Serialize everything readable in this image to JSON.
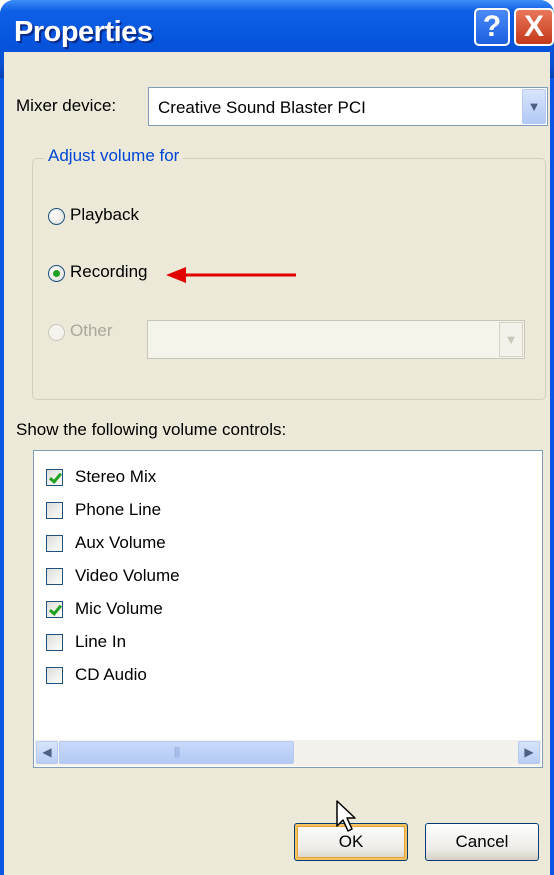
{
  "window": {
    "title": "Properties",
    "help_glyph": "?",
    "close_glyph": "X"
  },
  "mixer": {
    "label": "Mixer device:",
    "selected": "Creative Sound Blaster PCI",
    "arrow_glyph": "▼"
  },
  "adjust_volume": {
    "legend": "Adjust volume for",
    "options": [
      {
        "label": "Playback",
        "checked": false,
        "enabled": true
      },
      {
        "label": "Recording",
        "checked": true,
        "enabled": true
      },
      {
        "label": "Other",
        "checked": false,
        "enabled": false
      }
    ],
    "other_select_value": ""
  },
  "controls": {
    "heading": "Show the following volume controls:",
    "items": [
      {
        "label": "Stereo Mix",
        "checked": true
      },
      {
        "label": "Phone Line",
        "checked": false
      },
      {
        "label": "Aux Volume",
        "checked": false
      },
      {
        "label": "Video Volume",
        "checked": false
      },
      {
        "label": "Mic Volume",
        "checked": true
      },
      {
        "label": "Line In",
        "checked": false
      },
      {
        "label": "CD Audio",
        "checked": false
      }
    ]
  },
  "scrollbar": {
    "left_glyph": "◀",
    "right_glyph": "▶",
    "thumb_grip": "|||"
  },
  "buttons": {
    "ok": "OK",
    "cancel": "Cancel"
  },
  "annotation": {
    "arrow_color": "#e00000"
  },
  "colors": {
    "titlebar": "#0654dd",
    "dialog_bg": "#ece9d8",
    "group_legend": "#0046d5",
    "check_green": "#21a121"
  }
}
